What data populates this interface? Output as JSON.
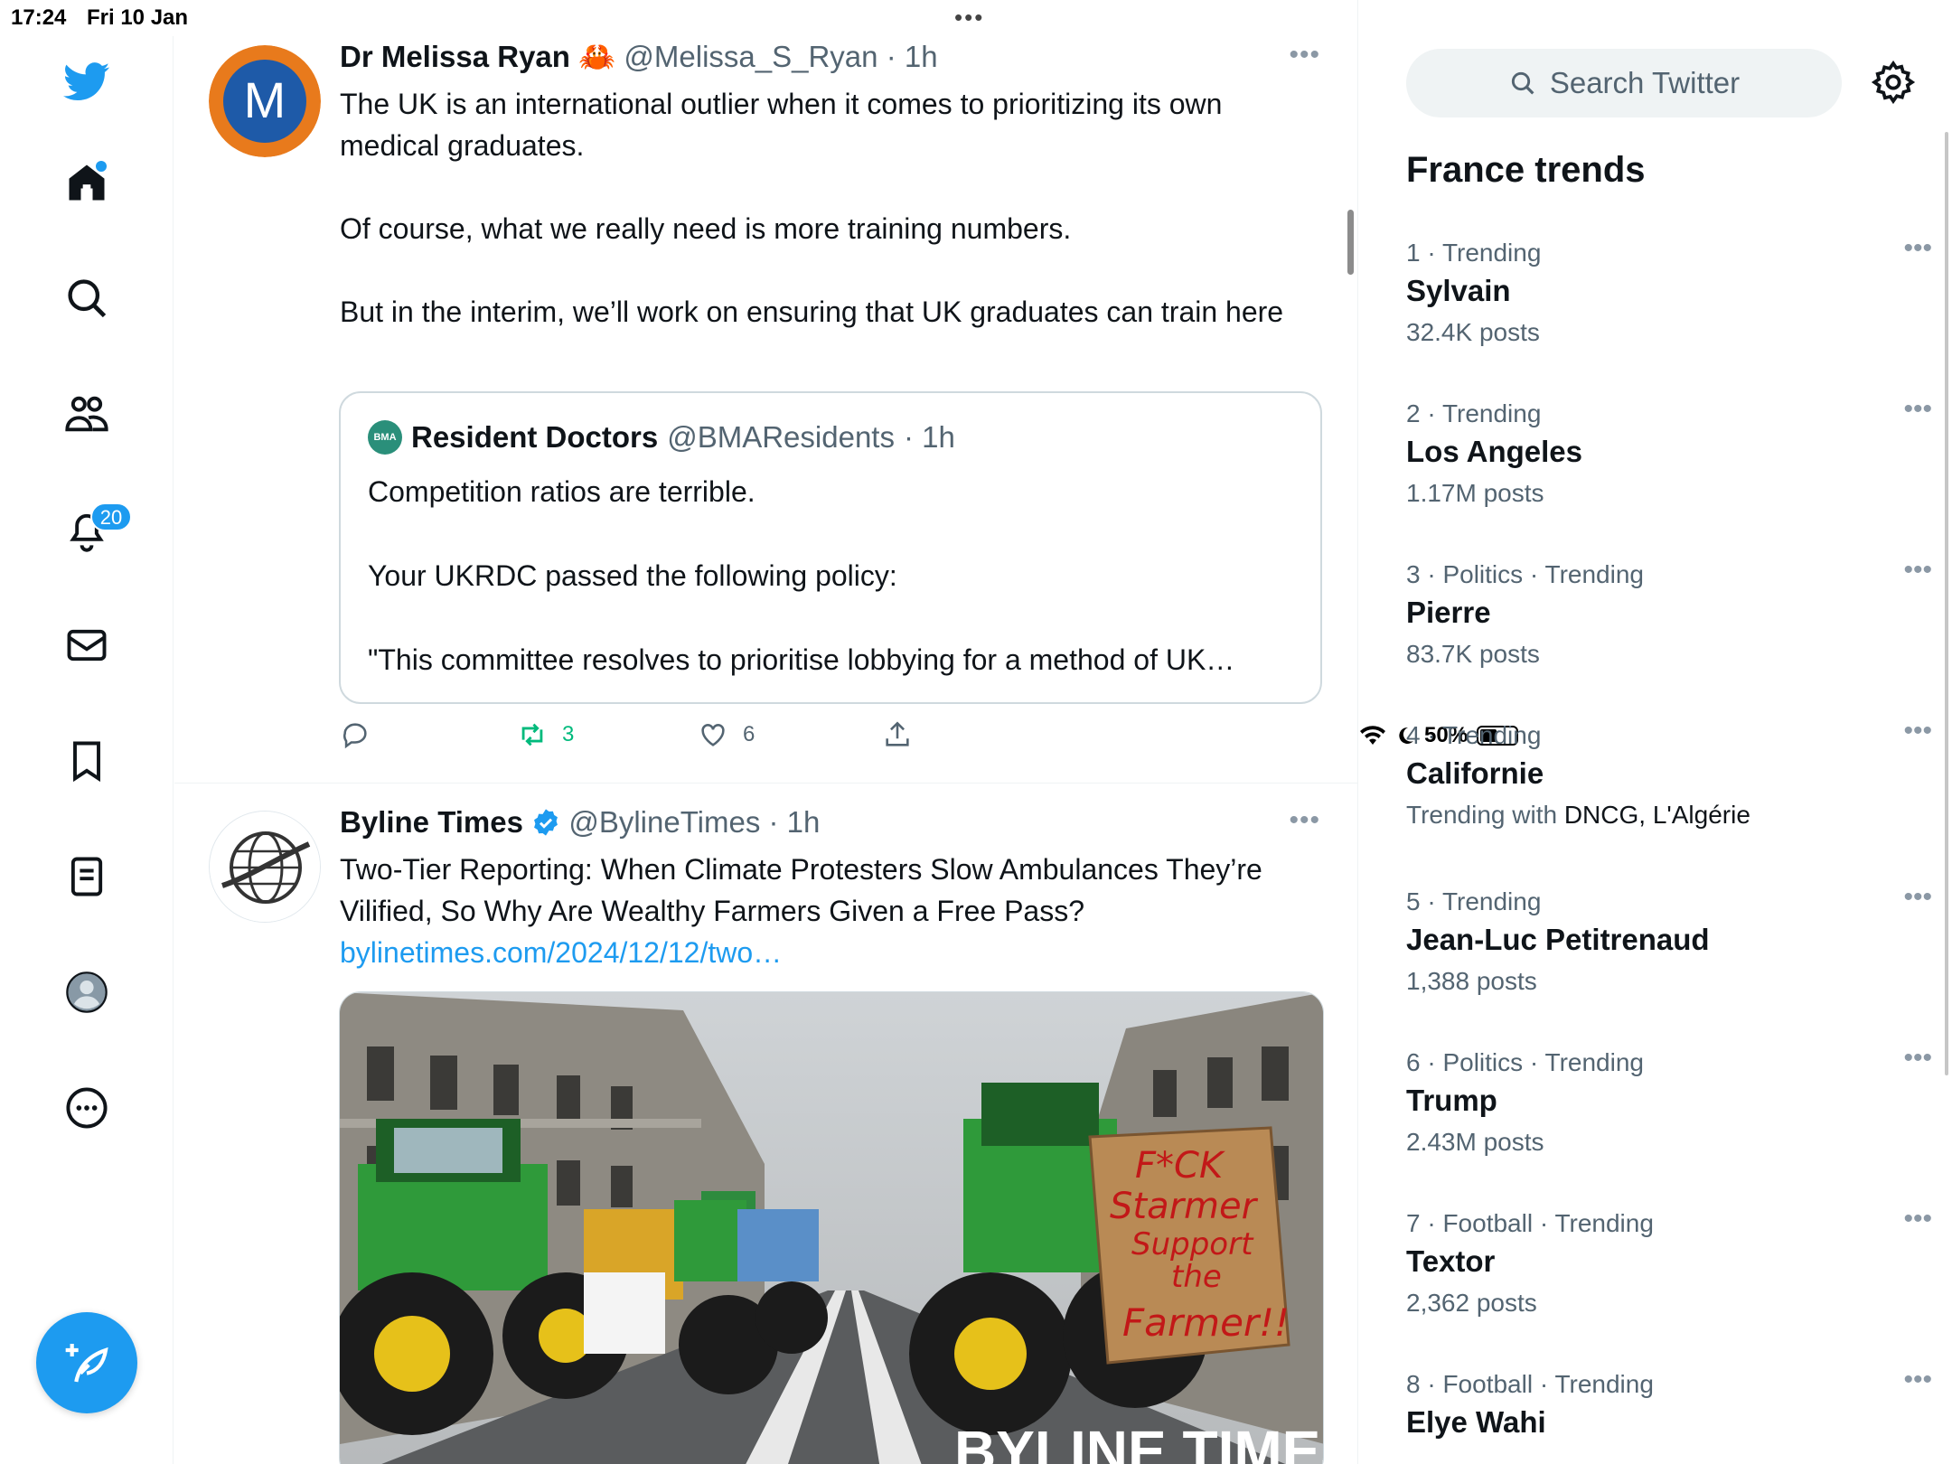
{
  "status_bar": {
    "time": "17:24",
    "date": "Fri 10 Jan",
    "battery": "50%",
    "multitask_dots": "•••"
  },
  "nav": {
    "notifications_badge": "20"
  },
  "tweets": [
    {
      "name": "Dr Melissa Ryan",
      "emoji": "🦀",
      "handle": "@Melissa_S_Ryan",
      "time": "· 1h",
      "avatar_letter": "M",
      "paragraphs": [
        "The UK is an international outlier when it comes to prioritizing its own medical graduates.",
        "Of course, what we really need is more training numbers.",
        "But in the interim, we’ll work on ensuring that UK graduates can train here"
      ],
      "quote": {
        "logo_text": "BMA",
        "name": "Resident Doctors",
        "handle": "@BMAResidents",
        "time": "· 1h",
        "paragraphs": [
          "Competition ratios are terrible.",
          "Your UKRDC passed the following policy:",
          "\"This committee resolves to prioritise lobbying for a method of UK…"
        ]
      },
      "retweets": "3",
      "likes": "6"
    },
    {
      "name": "Byline Times",
      "handle": "@BylineTimes",
      "time": "· 1h",
      "text": "Two-Tier Reporting: When Climate Protesters Slow Ambulances They’re Vilified, So Why Are Wealthy Farmers Given a Free Pass?",
      "link": "bylinetimes.com/2024/12/12/two…",
      "image": {
        "sign_line1": "F*CK",
        "sign_line2": "Starmer",
        "sign_line3": "Support",
        "sign_line4": "the",
        "sign_line5": "Farmer!!",
        "watermark": "BYLINE TIMES"
      }
    }
  ],
  "search": {
    "placeholder": "Search Twitter"
  },
  "trends": {
    "title": "France trends",
    "items": [
      {
        "meta": "1 · Trending",
        "topic": "Sylvain",
        "count": "32.4K posts"
      },
      {
        "meta": "2 · Trending",
        "topic": "Los Angeles",
        "count": "1.17M posts"
      },
      {
        "meta": "3 · Politics · Trending",
        "topic": "Pierre",
        "count": "83.7K posts"
      },
      {
        "meta": "4 · Trending",
        "topic": "Californie",
        "count_prefix": "Trending with ",
        "count_strong": "DNCG, L'Algérie"
      },
      {
        "meta": "5 · Trending",
        "topic": "Jean-Luc Petitrenaud",
        "count": "1,388 posts"
      },
      {
        "meta": "6 · Politics · Trending",
        "topic": "Trump",
        "count": "2.43M posts"
      },
      {
        "meta": "7 · Football · Trending",
        "topic": "Textor",
        "count": "2,362 posts"
      },
      {
        "meta": "8 · Football · Trending",
        "topic": "Elye Wahi",
        "count": ""
      }
    ]
  },
  "colors": {
    "accent": "#1d9bf0",
    "retweet_green": "#00ba7c",
    "secondary_text": "#536471"
  }
}
